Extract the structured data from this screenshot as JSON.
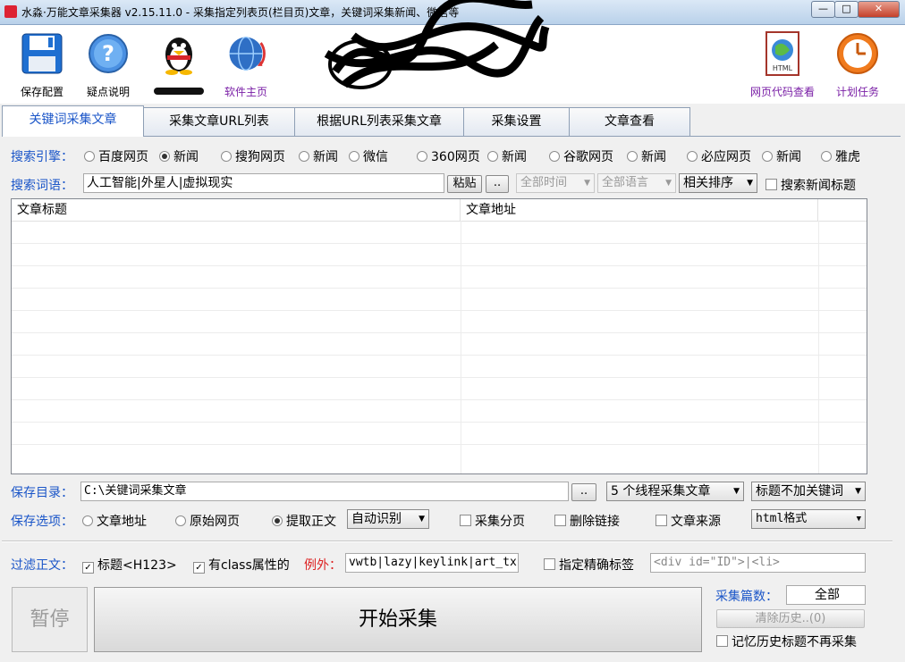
{
  "window": {
    "title": "水淼·万能文章采集器 v2.15.11.0 - 采集指定列表页(栏目页)文章，关键词采集新闻、微信等",
    "min": "—",
    "max": "□",
    "close": "✕"
  },
  "toolbar": {
    "save_config": "保存配置",
    "help": "疑点说明",
    "homepage": "软件主页",
    "view_source": "网页代码查看",
    "schedule": "计划任务"
  },
  "tabs": [
    "关键词采集文章",
    "采集文章URL列表",
    "根据URL列表采集文章",
    "采集设置",
    "文章查看"
  ],
  "search": {
    "engine_label": "搜索引擎：",
    "engines": [
      {
        "label": "百度网页",
        "checked": false
      },
      {
        "label": "新闻",
        "checked": true
      },
      {
        "label": "搜狗网页",
        "checked": false
      },
      {
        "label": "新闻",
        "checked": false
      },
      {
        "label": "微信",
        "checked": false
      },
      {
        "label": "360网页",
        "checked": false
      },
      {
        "label": "新闻",
        "checked": false
      },
      {
        "label": "谷歌网页",
        "checked": false
      },
      {
        "label": "新闻",
        "checked": false
      },
      {
        "label": "必应网页",
        "checked": false
      },
      {
        "label": "新闻",
        "checked": false
      },
      {
        "label": "雅虎",
        "checked": false
      }
    ],
    "keyword_label": "搜索词语：",
    "keywords": "人工智能|外星人|虚拟现实",
    "paste": "粘贴",
    "more": "..",
    "time_filter": "全部时间",
    "lang_filter": "全部语言",
    "sort": "相关排序",
    "news_title_check": "搜索新闻标题"
  },
  "grid": {
    "col_title": "文章标题",
    "col_url": "文章地址"
  },
  "save": {
    "dir_label": "保存目录：",
    "dir": "C:\\关键词采集文章",
    "browse": "..",
    "threads": "5 个线程采集文章",
    "title_kw": "标题不加关键词",
    "opt_label": "保存选项：",
    "radio_url": "文章地址",
    "radio_raw": "原始网页",
    "radio_text": "提取正文",
    "auto_detect": "自动识别",
    "chk_paging": "采集分页",
    "chk_del_links": "删除链接",
    "chk_source": "文章来源",
    "format": "html格式"
  },
  "filter": {
    "label": "过滤正文：",
    "chk_h123": "标题<H123>",
    "chk_class": "有class属性的",
    "except_label": "例外：",
    "except_value": "vwtb|lazy|keylink|art_tx",
    "chk_exact": "指定精确标签",
    "exact_placeholder": "<div id=\"ID\">|<li>"
  },
  "bottom": {
    "pause": "暂停",
    "start": "开始采集",
    "count_label": "采集篇数：",
    "count_value": "全部",
    "clear_history": "清除历史..(0)",
    "remember": "记忆历史标题不再采集"
  }
}
